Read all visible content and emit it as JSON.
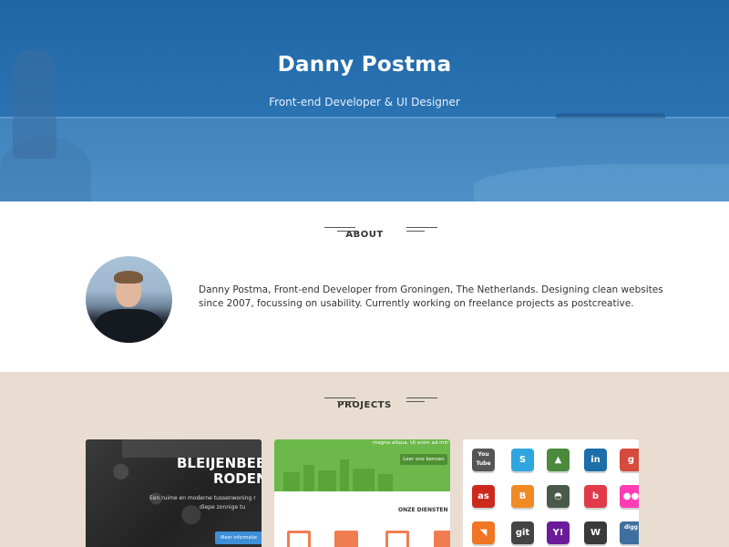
{
  "hero": {
    "name": "Danny Postma",
    "subtitle": "Front-end Developer & UI Designer"
  },
  "about": {
    "heading": "ABOUT",
    "text": "Danny Postma, Front-end Developer from Groningen, The Netherlands. Designing clean websites since 2007, focussing on usability. Currently working on freelance projects as postcreative."
  },
  "projects": {
    "heading": "PROJECTS",
    "card1": {
      "title_line1": "BLEIJENBEE",
      "title_line2": "RODEN",
      "text_line1": "Een ruime en moderne tussenwoning r",
      "text_line2": "diepe zonnige tu",
      "button": "Meer informatie"
    },
    "card2": {
      "top_text": "magna aliqua. Ut enim ad min",
      "button": "Leer ons kennen",
      "section_label": "ONZE DIENSTEN"
    },
    "card3": {
      "icons": [
        {
          "name": "youtube",
          "label": "You Tube",
          "color": "#555555"
        },
        {
          "name": "skype",
          "label": "S",
          "color": "#2fa6e0"
        },
        {
          "name": "forrst",
          "label": "▲",
          "color": "#4b8a3b"
        },
        {
          "name": "linkedin",
          "label": "in",
          "color": "#1b6ea8"
        },
        {
          "name": "google",
          "label": "g",
          "color": "#d54b3d"
        },
        {
          "name": "lastfm",
          "label": "as",
          "color": "#cc2a1d"
        },
        {
          "name": "blogger",
          "label": "B",
          "color": "#f08a24"
        },
        {
          "name": "delicious",
          "label": "◓",
          "color": "#4a5a4a"
        },
        {
          "name": "behance",
          "label": "b",
          "color": "#e23a4a"
        },
        {
          "name": "flickr",
          "label": "●●",
          "color": "#ff3cb4"
        },
        {
          "name": "rss",
          "label": "◥",
          "color": "#f07524"
        },
        {
          "name": "git",
          "label": "git",
          "color": "#444444"
        },
        {
          "name": "yahoo",
          "label": "Y!",
          "color": "#6a1b9a"
        },
        {
          "name": "wordpress",
          "label": "W",
          "color": "#3a3a3a"
        },
        {
          "name": "digg",
          "label": "digg",
          "color": "#3f6f9e"
        }
      ]
    }
  }
}
